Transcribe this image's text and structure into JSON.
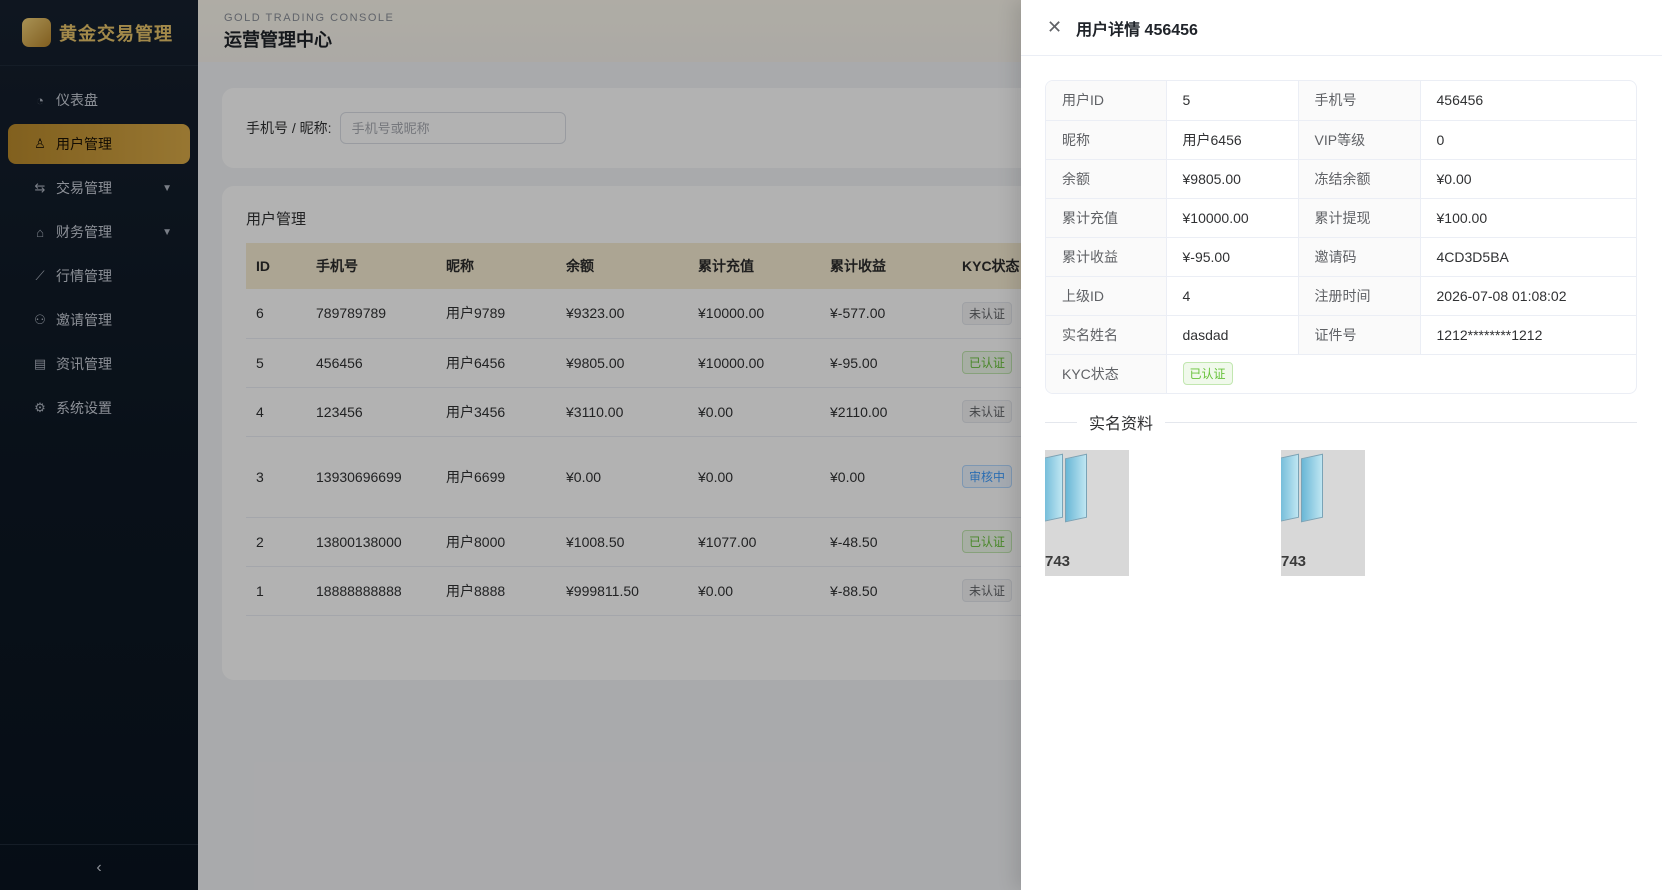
{
  "sidebar": {
    "brand": "黄金交易管理",
    "items": [
      {
        "label": "仪表盘",
        "icon": "dashboard-icon",
        "glyph": "◔"
      },
      {
        "label": "用户管理",
        "icon": "user-icon",
        "glyph": "♙"
      },
      {
        "label": "交易管理",
        "icon": "exchange-icon",
        "glyph": "⇆"
      },
      {
        "label": "财务管理",
        "icon": "bank-icon",
        "glyph": "⌂"
      },
      {
        "label": "行情管理",
        "icon": "chart-icon",
        "glyph": "⟋"
      },
      {
        "label": "邀请管理",
        "icon": "invite-icon",
        "glyph": "⚇"
      },
      {
        "label": "资讯管理",
        "icon": "document-icon",
        "glyph": "▤"
      },
      {
        "label": "系统设置",
        "icon": "gear-icon",
        "glyph": "⚙"
      }
    ],
    "collapse_glyph": "‹"
  },
  "header": {
    "subtitle": "GOLD TRADING CONSOLE",
    "title": "运营管理中心"
  },
  "search": {
    "label": "手机号 / 昵称:",
    "placeholder": "手机号或昵称"
  },
  "table": {
    "title": "用户管理",
    "columns": [
      "ID",
      "手机号",
      "昵称",
      "余额",
      "累计充值",
      "累计收益",
      "KYC状态"
    ],
    "rows": [
      {
        "id": "6",
        "phone": "789789789",
        "nickname": "用户9789",
        "balance": "¥9323.00",
        "recharge": "¥10000.00",
        "profit": "¥-577.00",
        "kyc": "未认证"
      },
      {
        "id": "5",
        "phone": "456456",
        "nickname": "用户6456",
        "balance": "¥9805.00",
        "recharge": "¥10000.00",
        "profit": "¥-95.00",
        "kyc": "已认证"
      },
      {
        "id": "4",
        "phone": "123456",
        "nickname": "用户3456",
        "balance": "¥3110.00",
        "recharge": "¥0.00",
        "profit": "¥2110.00",
        "kyc": "未认证"
      },
      {
        "id": "3",
        "phone": "13930696699",
        "nickname": "用户6699",
        "balance": "¥0.00",
        "recharge": "¥0.00",
        "profit": "¥0.00",
        "kyc": "审核中"
      },
      {
        "id": "2",
        "phone": "13800138000",
        "nickname": "用户8000",
        "balance": "¥1008.50",
        "recharge": "¥1077.00",
        "profit": "¥-48.50",
        "kyc": "已认证"
      },
      {
        "id": "1",
        "phone": "18888888888",
        "nickname": "用户8888",
        "balance": "¥999811.50",
        "recharge": "¥0.00",
        "profit": "¥-88.50",
        "kyc": "未认证"
      }
    ]
  },
  "drawer": {
    "title": "用户详情 456456",
    "fields": [
      {
        "l1": "用户ID",
        "v1": "5",
        "l2": "手机号",
        "v2": "456456"
      },
      {
        "l1": "昵称",
        "v1": "用户6456",
        "l2": "VIP等级",
        "v2": "0"
      },
      {
        "l1": "余额",
        "v1": "¥9805.00",
        "l2": "冻结余额",
        "v2": "¥0.00"
      },
      {
        "l1": "累计充值",
        "v1": "¥10000.00",
        "l2": "累计提现",
        "v2": "¥100.00"
      },
      {
        "l1": "累计收益",
        "v1": "¥-95.00",
        "l2": "邀请码",
        "v2": "4CD3D5BA"
      },
      {
        "l1": "上级ID",
        "v1": "4",
        "l2": "注册时间",
        "v2": "2026-07-08 01:08:02"
      },
      {
        "l1": "实名姓名",
        "v1": "dasdad",
        "l2": "证件号",
        "v2": "1212********1212"
      }
    ],
    "kyc_label": "KYC状态",
    "kyc_value": "已认证",
    "section_title": "实名资料",
    "images": [
      {
        "caption": "743"
      },
      {
        "caption": "743"
      }
    ]
  }
}
